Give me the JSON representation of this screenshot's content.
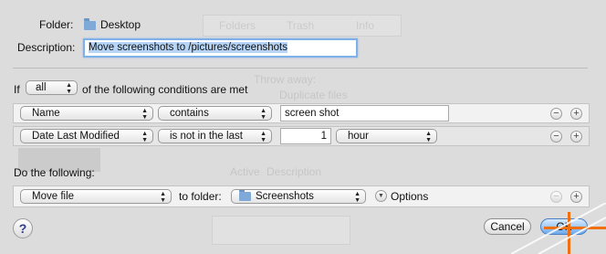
{
  "folder": {
    "label": "Folder:",
    "name": "Desktop"
  },
  "description": {
    "label": "Description:",
    "value": "Move screenshots to /pictures/screenshots"
  },
  "conditions_header": {
    "prefix": "If",
    "match": "all",
    "suffix": "of the following conditions are met"
  },
  "conditions": [
    {
      "attribute": "Name",
      "operator": "contains",
      "value": "screen shot"
    },
    {
      "attribute": "Date Last Modified",
      "operator": "is not in the last",
      "amount": "1",
      "unit": "hour"
    }
  ],
  "actions_header": "Do the following:",
  "action": {
    "type": "Move file",
    "to_label": "to folder:",
    "folder": "Screenshots",
    "options_label": "Options"
  },
  "buttons": {
    "help": "?",
    "cancel": "Cancel",
    "ok": "OK",
    "remove": "−",
    "add": "+"
  },
  "background": {
    "tabs": [
      "Folders",
      "Trash",
      "Info"
    ],
    "throw_away": "Throw away:",
    "duplicate": "Duplicate files",
    "active": "Active",
    "desc_col": "Description"
  }
}
